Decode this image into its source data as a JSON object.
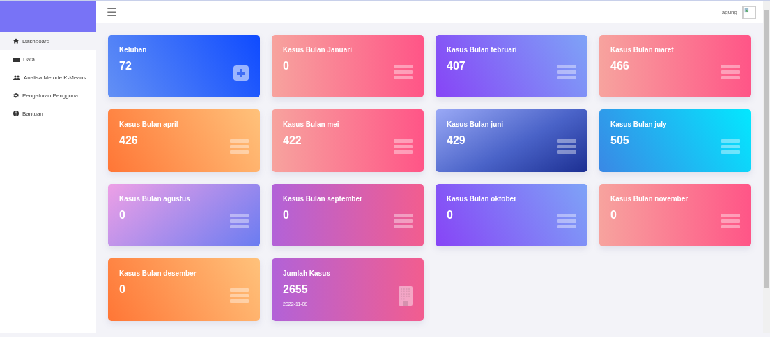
{
  "header": {
    "menu_icon": "☰",
    "user": "agung"
  },
  "sidebar": {
    "items": [
      {
        "label": "Dashboard",
        "selected": true
      },
      {
        "label": "Data",
        "selected": false
      },
      {
        "label": "Analisa Metode K-Means",
        "selected": false
      },
      {
        "label": "Pengaturan Pengguna",
        "selected": false
      },
      {
        "label": "Bantuan",
        "selected": false
      }
    ]
  },
  "cards": [
    {
      "kind": "complaint",
      "title": "Keluhan",
      "value": "72"
    },
    {
      "kind": "month",
      "title": "Kasus Bulan Januari",
      "value": "0"
    },
    {
      "kind": "month",
      "title": "Kasus Bulan februari",
      "value": "407"
    },
    {
      "kind": "month",
      "title": "Kasus Bulan maret",
      "value": "466"
    },
    {
      "kind": "month",
      "title": "Kasus Bulan april",
      "value": "426"
    },
    {
      "kind": "month",
      "title": "Kasus Bulan mei",
      "value": "422"
    },
    {
      "kind": "month",
      "title": "Kasus Bulan juni",
      "value": "429"
    },
    {
      "kind": "month",
      "title": "Kasus Bulan july",
      "value": "505"
    },
    {
      "kind": "month",
      "title": "Kasus Bulan agustus",
      "value": "0"
    },
    {
      "kind": "month",
      "title": "Kasus Bulan september",
      "value": "0"
    },
    {
      "kind": "month",
      "title": "Kasus Bulan oktober",
      "value": "0"
    },
    {
      "kind": "month",
      "title": "Kasus Bulan november",
      "value": "0"
    },
    {
      "kind": "month",
      "title": "Kasus Bulan desember",
      "value": "0"
    },
    {
      "kind": "total",
      "title": "Jumlah Kasus",
      "value": "2655",
      "date": "2022-11-09"
    }
  ]
}
